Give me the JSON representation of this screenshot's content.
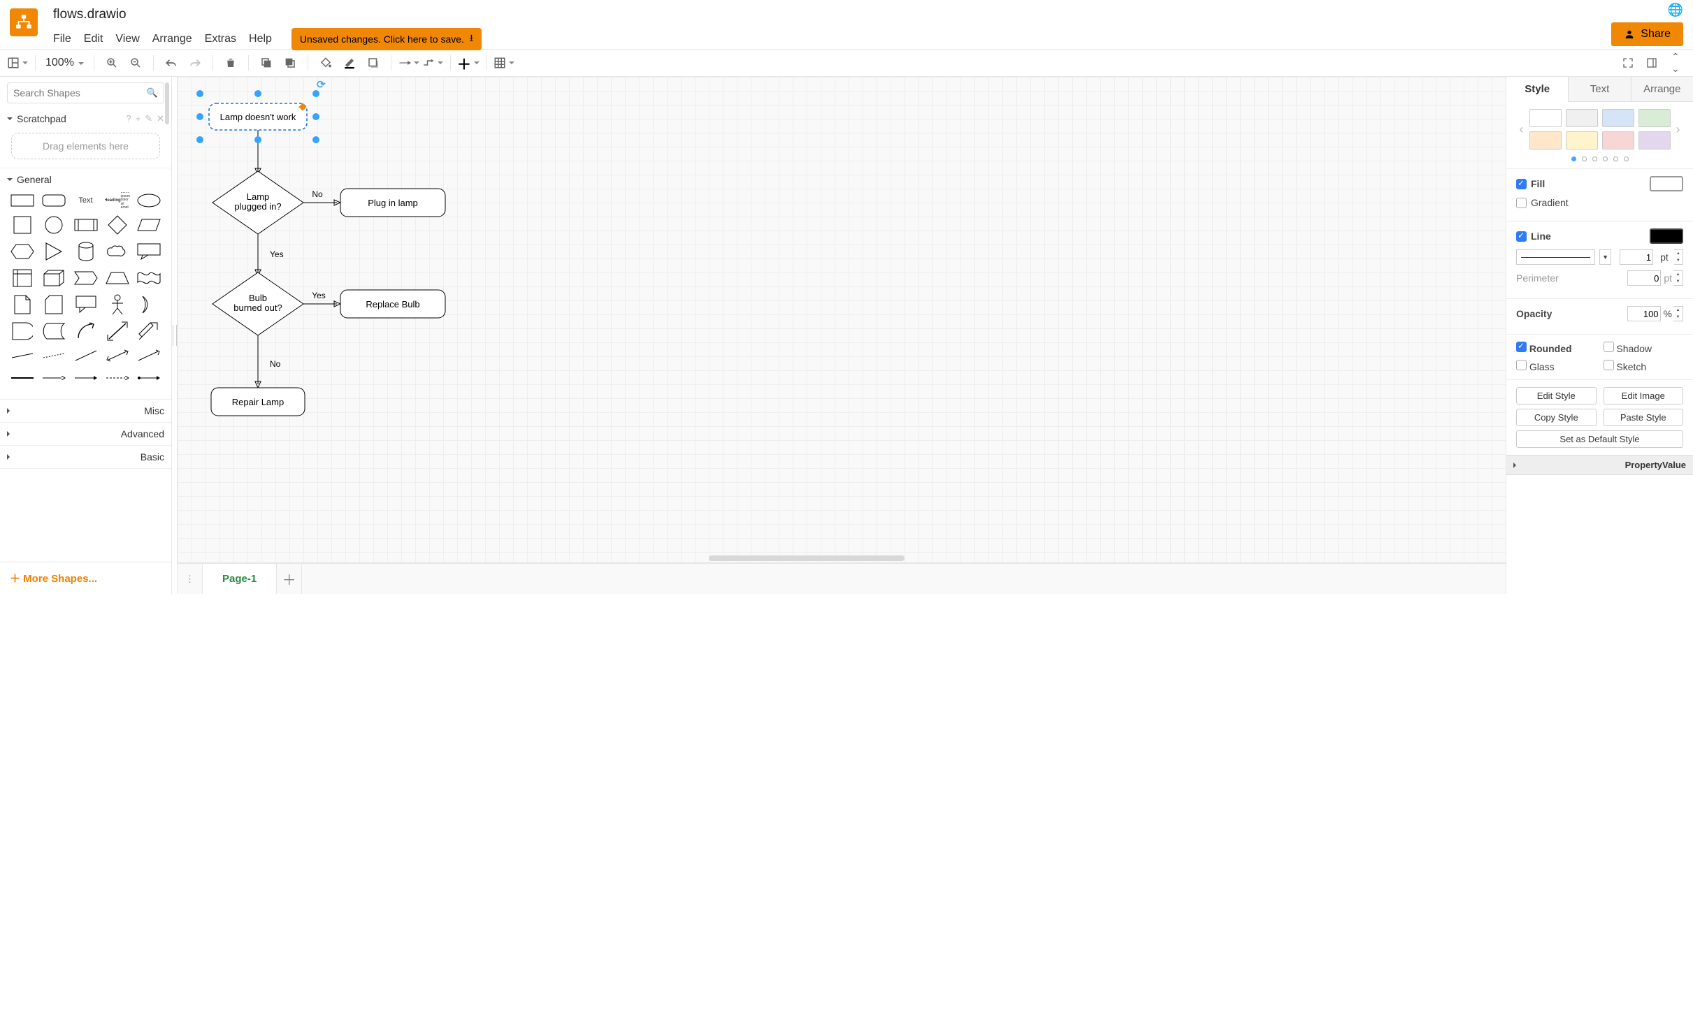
{
  "filename": "flows.drawio",
  "menubar": [
    "File",
    "Edit",
    "View",
    "Arrange",
    "Extras",
    "Help"
  ],
  "save_banner": "Unsaved changes. Click here to save.",
  "share_label": "Share",
  "zoom": "100%",
  "left": {
    "search_placeholder": "Search Shapes",
    "scratchpad_label": "Scratchpad",
    "scratchpad_hint": "Drag elements here",
    "cats": {
      "general": "General",
      "misc": "Misc",
      "advanced": "Advanced",
      "basic": "Basic"
    },
    "more_shapes": "More Shapes..."
  },
  "flowchart": {
    "n0": "Lamp doesn't work",
    "n1": "Lamp\nplugged in?",
    "n2": "Plug in lamp",
    "n3": "Bulb\nburned out?",
    "n4": "Replace Bulb",
    "n5": "Repair Lamp",
    "e01_no": "No",
    "e12_yes": "Yes",
    "e34_yes": "Yes",
    "e35_no": "No"
  },
  "tabs": {
    "page1": "Page-1"
  },
  "right": {
    "tabs": {
      "style": "Style",
      "text": "Text",
      "arrange": "Arrange"
    },
    "swatches": [
      "#ffffff",
      "#f0f0f0",
      "#d6e4f7",
      "#d9ecd6",
      "#ffe7cc",
      "#fff4cc",
      "#f9d6d6",
      "#e3d7ee"
    ],
    "fill_label": "Fill",
    "gradient_label": "Gradient",
    "line_label": "Line",
    "line_width": "1",
    "line_unit": "pt",
    "perimeter_label": "Perimeter",
    "perimeter_val": "0",
    "perimeter_unit": "pt",
    "opacity_label": "Opacity",
    "opacity_val": "100",
    "opacity_unit": "%",
    "rounded": "Rounded",
    "shadow": "Shadow",
    "glass": "Glass",
    "sketch": "Sketch",
    "edit_style": "Edit Style",
    "edit_image": "Edit Image",
    "copy_style": "Copy Style",
    "paste_style": "Paste Style",
    "set_default": "Set as Default Style",
    "prop": "Property",
    "val": "Value"
  }
}
